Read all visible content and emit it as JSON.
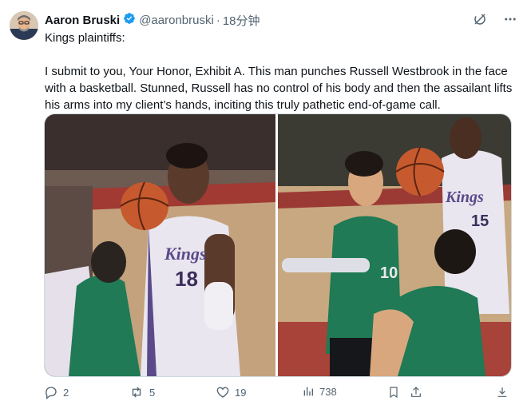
{
  "author": {
    "name": "Aaron Bruski",
    "handle": "@aaronbruski",
    "separator": "·",
    "time": "18分钟"
  },
  "tweet": {
    "line1": "Kings plaintiffs:",
    "line2": "I submit to you, Your Honor, Exhibit A. This man punches Russell Westbrook in the face with a basketball. Stunned, Russell has no control of his body and then the assailant lifts his arms into my client’s hands, inciting this truly pathetic end-of-game call."
  },
  "media": {
    "left_jersey_brand": "Kings",
    "left_jersey_number": "18",
    "right_jersey_brand": "Kings",
    "right_jersey_number": "15",
    "right_opponent_number": "10"
  },
  "actions": {
    "replies": "2",
    "retweets": "5",
    "likes": "19",
    "views": "738"
  },
  "colors": {
    "verified": "#1d9bf0",
    "text": "#0f1419",
    "secondary": "#536471",
    "court": "#b04a3a",
    "green_jersey": "#1f7a55",
    "kings_white": "#e9e6ef",
    "kings_purple": "#5a4a8a"
  },
  "icons": [
    "verified-badge-icon",
    "grok-icon",
    "more-icon",
    "reply-icon",
    "retweet-icon",
    "like-icon",
    "views-icon",
    "bookmark-icon",
    "share-icon"
  ]
}
